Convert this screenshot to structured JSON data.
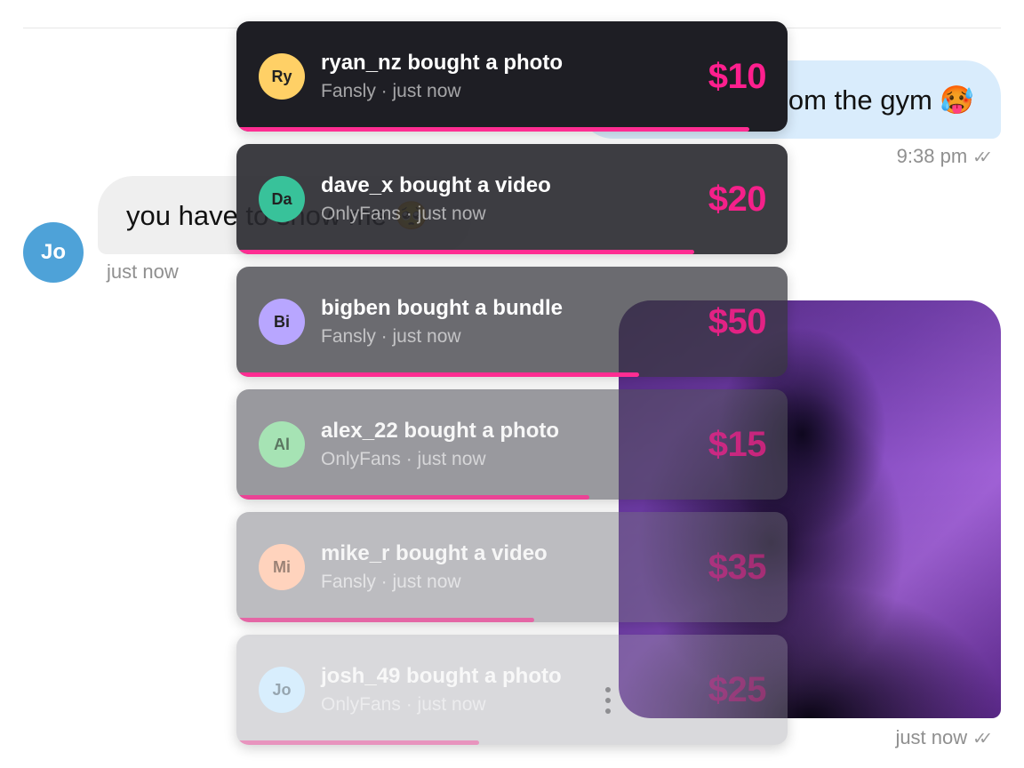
{
  "chat": {
    "outgoing_message": {
      "text": "om the gym 🥵",
      "time": "9:38 pm"
    },
    "incoming_message": {
      "text": "you have to show me 🥺",
      "time": "just now",
      "sender_initials": "Jo"
    },
    "media_message": {
      "time": "just now"
    }
  },
  "colors": {
    "accent": "#ff1f8e",
    "outgoing_bubble": "#d9ecfc",
    "incoming_bubble": "#efefef",
    "avatar_jo": "#4ea2d8"
  },
  "notifications": [
    {
      "initials": "Ry",
      "title": "ryan_nz bought a photo",
      "subtitle": "Fansly · just now",
      "amount": "$10",
      "progress": 0.93
    },
    {
      "initials": "Da",
      "title": "dave_x bought a video",
      "subtitle": "OnlyFans · just now",
      "amount": "$20",
      "progress": 0.83
    },
    {
      "initials": "Bi",
      "title": "bigben bought a bundle",
      "subtitle": "Fansly · just now",
      "amount": "$50",
      "progress": 0.73
    },
    {
      "initials": "Al",
      "title": "alex_22 bought a photo",
      "subtitle": "OnlyFans · just now",
      "amount": "$15",
      "progress": 0.64
    },
    {
      "initials": "Mi",
      "title": "mike_r bought a video",
      "subtitle": "Fansly · just now",
      "amount": "$35",
      "progress": 0.54
    },
    {
      "initials": "Jo",
      "title": "josh_49 bought a photo",
      "subtitle": "OnlyFans · just now",
      "amount": "$25",
      "progress": 0.44
    }
  ]
}
